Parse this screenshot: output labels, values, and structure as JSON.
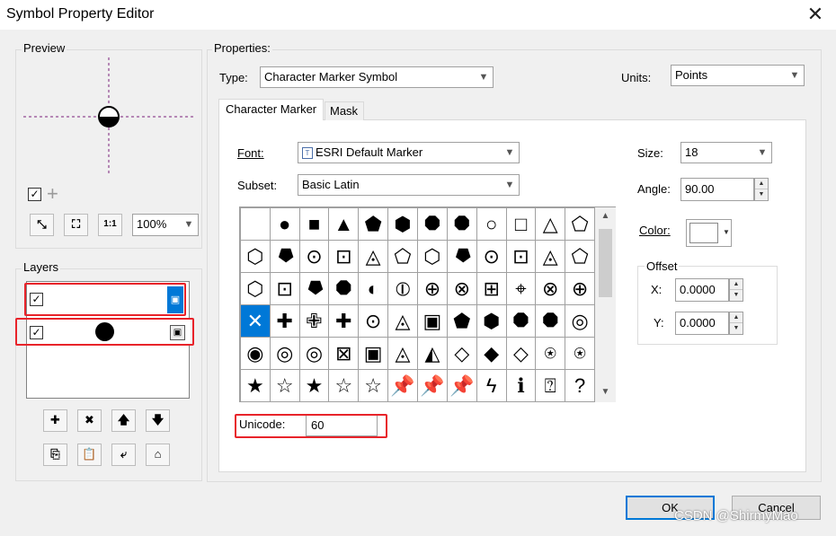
{
  "window": {
    "title": "Symbol Property Editor",
    "close_glyph": "✕"
  },
  "preview": {
    "group_label": "Preview",
    "zoom": "100%",
    "toolbar": [
      {
        "name": "zoom-in-icon",
        "glyph": "⤡"
      },
      {
        "name": "zoom-fit-icon",
        "glyph": "⛶"
      },
      {
        "name": "actual-size-icon",
        "glyph": "1:1"
      }
    ],
    "check_glyph": "✓",
    "plus_glyph": "+"
  },
  "layers": {
    "group_label": "Layers",
    "items": [
      {
        "checked": true,
        "has_symbol": false
      },
      {
        "checked": true,
        "has_symbol": true
      }
    ],
    "buttons_row1": [
      {
        "name": "add-layer-button",
        "glyph": "✚"
      },
      {
        "name": "remove-layer-button",
        "glyph": "✖"
      },
      {
        "name": "move-up-button",
        "glyph": "🡅"
      },
      {
        "name": "move-down-button",
        "glyph": "🡇"
      }
    ],
    "buttons_row2": [
      {
        "name": "copy-layer-button",
        "glyph": "⎘"
      },
      {
        "name": "paste-layer-button",
        "glyph": "📋"
      },
      {
        "name": "reset-layer-button",
        "glyph": "⤶"
      },
      {
        "name": "tag-layer-button",
        "glyph": "⌂"
      }
    ]
  },
  "properties": {
    "group_label": "Properties:",
    "type_label": "Type:",
    "type_value": "Character Marker Symbol",
    "units_label": "Units:",
    "units_value": "Points",
    "tabs": [
      {
        "label": "Character Marker",
        "active": true
      },
      {
        "label": "Mask",
        "active": false
      }
    ],
    "font_label": "Font:",
    "font_value": "ESRI Default Marker",
    "subset_label": "Subset:",
    "subset_value": "Basic Latin",
    "unicode_label": "Unicode:",
    "unicode_value": "60",
    "size_label": "Size:",
    "size_value": "18",
    "angle_label": "Angle:",
    "angle_value": "90.00",
    "color_label": "Color:",
    "color_value": "#ffffff",
    "offset_label": "Offset",
    "x_label": "X:",
    "x_value": "0.0000",
    "y_label": "Y:",
    "y_value": "0.0000"
  },
  "glyph_grid": {
    "selected_index": 36,
    "rows": [
      [
        " ",
        "●",
        "■",
        "▲",
        "⬟",
        "⬢",
        "⯃",
        "⯃",
        "○",
        "□",
        "△",
        "⬠"
      ],
      [
        "⬡",
        "⯂",
        "⊙",
        "⊡",
        "◬",
        "⬠",
        "⬡",
        "⯂",
        "⊙",
        "⊡",
        "◬",
        "⬠"
      ],
      [
        "⬡",
        "⊡",
        "⯂",
        "⯃",
        "◐",
        "⦶",
        "⊕",
        "⊗",
        "⊞",
        "⌖",
        "⊗",
        "⊕"
      ],
      [
        "✕",
        "✚",
        "✙",
        "✚",
        "⊙",
        "◬",
        "▣",
        "⬟",
        "⬢",
        "⯃",
        "⯃",
        "◎"
      ],
      [
        "◉",
        "◎",
        "◎",
        "⊠",
        "▣",
        "◬",
        "◭",
        "◇",
        "◆",
        "◇",
        "⍟",
        "⍟"
      ],
      [
        "★",
        "☆",
        "★",
        "☆",
        "☆",
        "📌",
        "📌",
        "📌",
        "ϟ",
        "ℹ",
        "⍰",
        "?"
      ]
    ]
  },
  "buttons": {
    "ok": "OK",
    "cancel": "Cancel"
  },
  "watermark": "CSDN @ShirmyMao"
}
